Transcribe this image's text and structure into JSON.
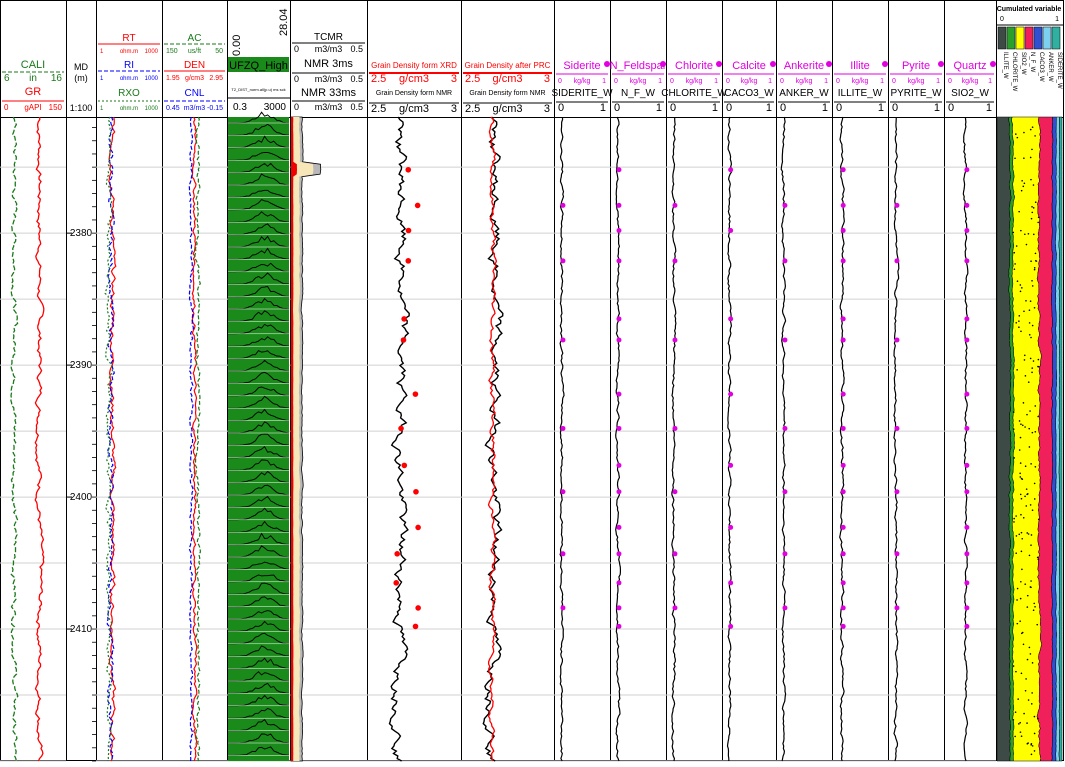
{
  "colors": {
    "red": "#ff0000",
    "green": "#1a7a1a",
    "blue": "#0000ff",
    "magenta": "#e000e0",
    "black": "#000000",
    "nmr_fill": "#1a8a1a",
    "t2_grey": "#b8b8b8",
    "t2_cream": "#f7e6b8",
    "t2_red": "#ee0000",
    "cum_dark": "#3d4a45",
    "cum_green": "#2aa02a",
    "cum_yellow": "#ffff00",
    "cum_red": "#f0205a",
    "cum_blue": "#3050d0",
    "cum_cyan": "#7cd0f0",
    "cum_teal": "#30b0a0"
  },
  "md": {
    "title": "MD",
    "unit": "(m)",
    "scale": "1:100",
    "depth_labels": [
      "2380",
      "2390",
      "2400",
      "2410"
    ]
  },
  "tracks": [
    {
      "id": "gr",
      "headers": [
        {
          "name": "CALI",
          "color": "#1a7a1a",
          "min": "6",
          "unit": "in",
          "max": "16"
        },
        {
          "name": "GR",
          "color": "#ff0000",
          "min": "0",
          "unit": "gAPI",
          "max": "150"
        }
      ]
    },
    {
      "id": "res",
      "headers": [
        {
          "name": "RT",
          "color": "#ff0000",
          "min": "1",
          "unit": "ohm.m",
          "max": "1000"
        },
        {
          "name": "RI",
          "color": "#0000ff",
          "min": "1",
          "unit": "ohm.m",
          "max": "1000"
        },
        {
          "name": "RXO",
          "color": "#1a7a1a",
          "min": "1",
          "unit": "ohm.m",
          "max": "1000"
        }
      ]
    },
    {
      "id": "por",
      "headers": [
        {
          "name": "AC",
          "color": "#1a7a1a",
          "min": "150",
          "unit": "us/ft",
          "max": "50"
        },
        {
          "name": "DEN",
          "color": "#ff0000",
          "min": "1.95",
          "unit": "g/cm3",
          "max": "2.95"
        },
        {
          "name": "CNL",
          "color": "#0000ff",
          "min": "0.45",
          "unit": "m3/m3",
          "max": "-0.15"
        }
      ]
    },
    {
      "id": "nmr",
      "headers": [
        {
          "name": "UFZQ_High",
          "min": "0.3",
          "max": "3000"
        }
      ],
      "vertical_labels": [
        "0.00",
        "28.04"
      ],
      "tiny_label": "T2_DIST_norm.all(p.u) ms   sck"
    },
    {
      "id": "nmrpor",
      "headers": [
        {
          "name": "TCMR",
          "min": "0",
          "unit": "m3/m3",
          "max": "0.5"
        },
        {
          "name": "NMR 3ms",
          "min": "0",
          "unit": "m3/m3",
          "max": "0.5"
        },
        {
          "name": "NMR 33ms",
          "min": "0",
          "unit": "m3/m3",
          "max": "0.5"
        }
      ]
    },
    {
      "id": "gdxrd",
      "headers": [
        {
          "name": "Grain Density form XRD",
          "color": "#ff0000",
          "min": "2.5",
          "unit": "g/cm3",
          "max": "3"
        },
        {
          "name": "Grain Density form NMR",
          "color": "#000000",
          "min": "2.5",
          "unit": "g/cm3",
          "max": "3"
        }
      ]
    },
    {
      "id": "gdprc",
      "headers": [
        {
          "name": "Grain Density after PRC",
          "color": "#ff0000",
          "min": "2.5",
          "unit": "g/cm3",
          "max": "3"
        },
        {
          "name": "Grain Density form NMR",
          "color": "#000000",
          "min": "2.5",
          "unit": "g/cm3",
          "max": "3"
        }
      ]
    },
    {
      "id": "sid",
      "headers": [
        {
          "name": "Siderite",
          "color": "#e000e0",
          "min": "0",
          "unit": "kg/kg",
          "max": "1"
        },
        {
          "name": "SIDERITE_W",
          "color": "#000000",
          "min": "0",
          "max": "1"
        }
      ]
    },
    {
      "id": "nfw",
      "headers": [
        {
          "name": "N_Feldspar",
          "color": "#e000e0",
          "min": "0",
          "unit": "kg/kg",
          "max": "1"
        },
        {
          "name": "N_F_W",
          "color": "#000000",
          "min": "0",
          "max": "1"
        }
      ]
    },
    {
      "id": "chl",
      "headers": [
        {
          "name": "Chlorite",
          "color": "#e000e0",
          "min": "0",
          "unit": "kg/kg",
          "max": "1"
        },
        {
          "name": "CHLORITE_W",
          "color": "#000000",
          "min": "0",
          "max": "1"
        }
      ]
    },
    {
      "id": "cal",
      "headers": [
        {
          "name": "Calcite",
          "color": "#e000e0",
          "min": "0",
          "unit": "kg/kg",
          "max": "1"
        },
        {
          "name": "CACO3_W",
          "color": "#000000",
          "min": "0",
          "max": "1"
        }
      ]
    },
    {
      "id": "ank",
      "headers": [
        {
          "name": "Ankerite",
          "color": "#e000e0",
          "min": "0",
          "unit": "kg/kg",
          "max": "1"
        },
        {
          "name": "ANKER_W",
          "color": "#000000",
          "min": "0",
          "max": "1"
        }
      ]
    },
    {
      "id": "ill",
      "headers": [
        {
          "name": "Illite",
          "color": "#e000e0",
          "min": "0",
          "unit": "kg/kg",
          "max": "1"
        },
        {
          "name": "ILLITE_W",
          "color": "#000000",
          "min": "0",
          "max": "1"
        }
      ]
    },
    {
      "id": "pyr",
      "headers": [
        {
          "name": "Pyrite",
          "color": "#e000e0",
          "min": "0",
          "unit": "kg/kg",
          "max": "1"
        },
        {
          "name": "PYRITE_W",
          "color": "#000000",
          "min": "0",
          "max": "1"
        }
      ]
    },
    {
      "id": "qtz",
      "headers": [
        {
          "name": "Quartz",
          "color": "#e000e0",
          "min": "0",
          "unit": "kg/kg",
          "max": "1"
        },
        {
          "name": "SIO2_W",
          "color": "#000000",
          "min": "0",
          "max": "1"
        }
      ]
    }
  ],
  "cumulated": {
    "title": "Cumulated variable",
    "min": "0",
    "max": "1",
    "legend": [
      "ILLITE_W",
      "CHLORITE_W",
      "SIO2_W",
      "N_F_W",
      "CACO3_W",
      "ANKER_W",
      "SIDERITE_W"
    ]
  },
  "chart_data": {
    "type": "well-log",
    "depth_range_m": [
      2371.2,
      2420.0
    ],
    "depth_ticks_m": [
      2380,
      2390,
      2400,
      2410
    ],
    "curve_note": "Log curves are dense wireline measurements; only core/XRD sample points and key ranges transcribed.",
    "core_sample_depths_m": [
      2375.2,
      2377.9,
      2379.8,
      2382.1,
      2386.5,
      2388.1,
      2392.2,
      2394.8,
      2397.6,
      2399.6,
      2402.3,
      2404.3,
      2406.5,
      2408.4,
      2409.8
    ]
  }
}
